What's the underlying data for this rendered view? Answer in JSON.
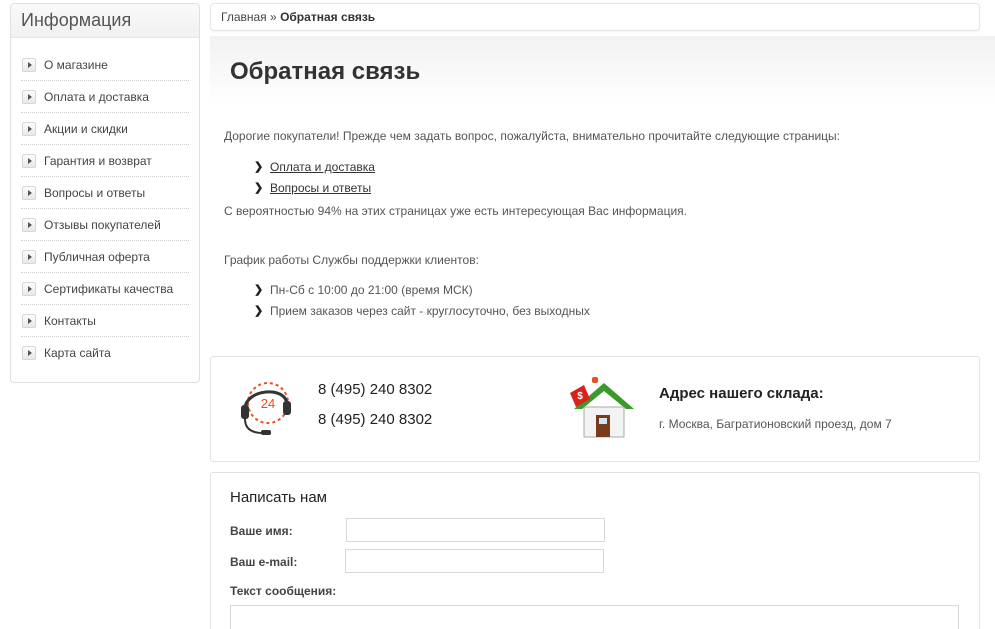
{
  "sidebar": {
    "title": "Информация",
    "items": [
      {
        "label": "О магазине"
      },
      {
        "label": "Оплата и доставка"
      },
      {
        "label": "Акции и скидки"
      },
      {
        "label": "Гарантия и возврат"
      },
      {
        "label": "Вопросы и ответы"
      },
      {
        "label": "Отзывы покупателей"
      },
      {
        "label": "Публичная оферта"
      },
      {
        "label": "Сертификаты качества"
      },
      {
        "label": "Контакты"
      },
      {
        "label": "Карта сайта"
      }
    ]
  },
  "breadcrumb": {
    "home": "Главная",
    "separator": "»",
    "current": "Обратная связь"
  },
  "page": {
    "title": "Обратная связь",
    "intro": "Дорогие покупатели! Прежде чем задать вопрос, пожалуйста, внимательно прочитайте следующие страницы:",
    "links": [
      "Оплата и доставка",
      "Вопросы и ответы"
    ],
    "probability_note": "С вероятностью 94% на этих страницах уже есть интересующая Вас информация.",
    "schedule_title": "График работы Службы поддержки клиентов:",
    "schedule": [
      "Пн-Сб с 10:00 до 21:00 (время МСК)",
      "Прием заказов через сайт - круглосуточно, без выходных"
    ]
  },
  "contacts": {
    "support_icon_text": "24",
    "phone1": "8 (495) 240 8302",
    "phone2": "8 (495) 240 8302",
    "address_title": "Адрес нашего склада:",
    "address": "г. Москва, Багратионовский проезд, дом 7",
    "house_tag": "$"
  },
  "form": {
    "title": "Написать нам",
    "name_label": "Ваше имя:",
    "email_label": "Ваш e-mail:",
    "message_label": "Текст сообщения:",
    "name_value": "",
    "email_value": ""
  },
  "colors": {
    "accent_orange": "#e8501e",
    "house_green": "#3a9a2a",
    "tag_red": "#d8231c"
  }
}
